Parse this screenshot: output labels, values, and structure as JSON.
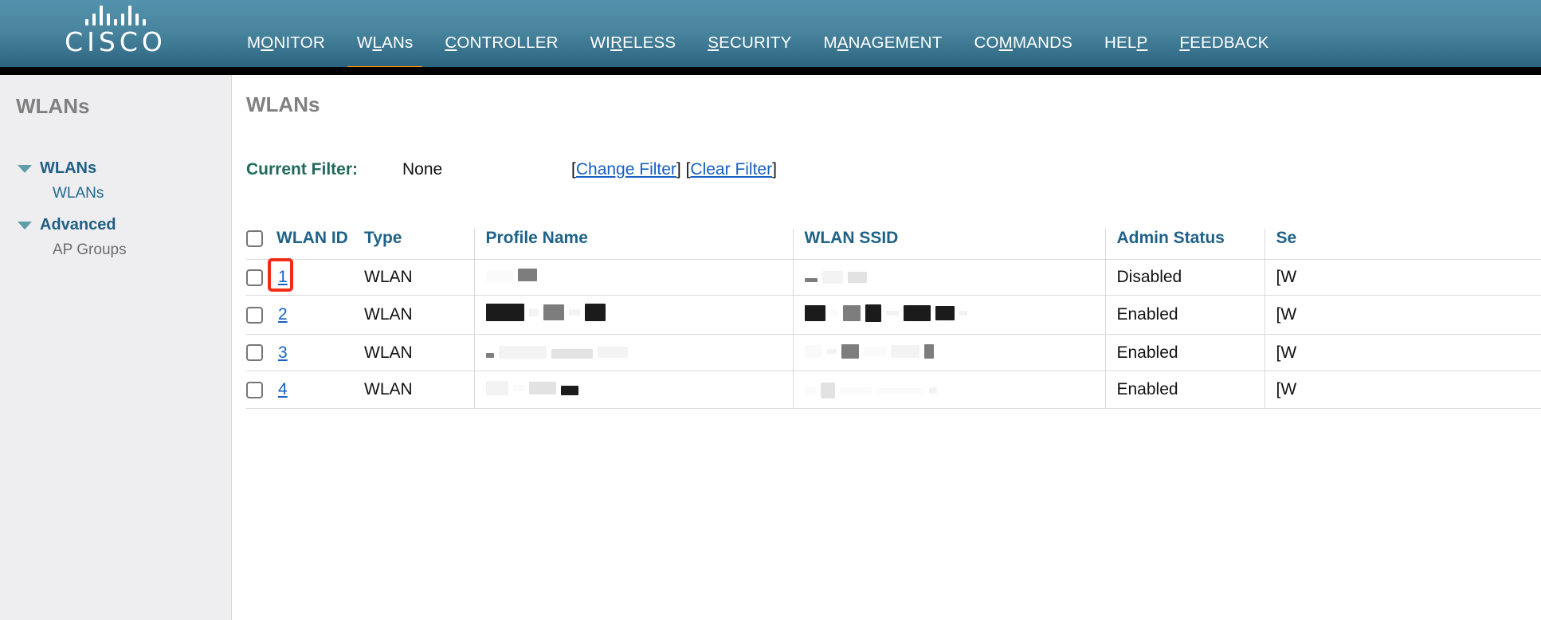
{
  "header": {
    "logo_name": "CISCO",
    "nav": [
      {
        "label": "MONITOR",
        "accesskey_index": 1,
        "active": false
      },
      {
        "label": "WLANs",
        "accesskey_index": 1,
        "active": true
      },
      {
        "label": "CONTROLLER",
        "accesskey_index": 0,
        "active": false
      },
      {
        "label": "WIRELESS",
        "accesskey_index": 2,
        "active": false
      },
      {
        "label": "SECURITY",
        "accesskey_index": 0,
        "active": false
      },
      {
        "label": "MANAGEMENT",
        "accesskey_index": 1,
        "active": false
      },
      {
        "label": "COMMANDS",
        "accesskey_index": 2,
        "active": false
      },
      {
        "label": "HELP",
        "accesskey_index": 3,
        "active": false
      },
      {
        "label": "FEEDBACK",
        "accesskey_index": 0,
        "active": false
      }
    ]
  },
  "sidebar": {
    "title": "WLANs",
    "groups": [
      {
        "label": "WLANs",
        "expanded": true,
        "items": [
          {
            "label": "WLANs",
            "style": "link"
          }
        ]
      },
      {
        "label": "Advanced",
        "expanded": true,
        "items": [
          {
            "label": "AP Groups",
            "style": "muted"
          }
        ]
      }
    ]
  },
  "content": {
    "title": "WLANs",
    "filter": {
      "label": "Current Filter:",
      "value": "None",
      "open_bracket": "[",
      "change_link": "Change Filter",
      "mid_brackets": "] [",
      "clear_link": "Clear Filter",
      "close_bracket": "]"
    },
    "table": {
      "columns": [
        {
          "key": "check",
          "label": ""
        },
        {
          "key": "id",
          "label": "WLAN ID"
        },
        {
          "key": "type",
          "label": "Type"
        },
        {
          "key": "profile",
          "label": "Profile Name"
        },
        {
          "key": "ssid",
          "label": "WLAN SSID"
        },
        {
          "key": "admin",
          "label": "Admin Status"
        },
        {
          "key": "sec",
          "label": "Se"
        }
      ],
      "rows": [
        {
          "id": "1",
          "id_highlighted": true,
          "type": "WLAN",
          "profile_redacted": true,
          "ssid_redacted": true,
          "admin": "Disabled",
          "security": "[W"
        },
        {
          "id": "2",
          "id_highlighted": false,
          "type": "WLAN",
          "profile_redacted": true,
          "ssid_redacted": true,
          "admin": "Enabled",
          "security": "[W"
        },
        {
          "id": "3",
          "id_highlighted": false,
          "type": "WLAN",
          "profile_redacted": true,
          "ssid_redacted": true,
          "admin": "Enabled",
          "security": "[W"
        },
        {
          "id": "4",
          "id_highlighted": false,
          "type": "WLAN",
          "profile_redacted": true,
          "ssid_redacted": true,
          "admin": "Enabled",
          "security": "[W"
        }
      ]
    }
  },
  "colors": {
    "header_top": "#5492ad",
    "header_bottom": "#2d6480",
    "active_tab": "#ff9500",
    "link": "#1660c4",
    "table_header_text": "#1f6288",
    "filter_label": "#1f6a5a",
    "sidebar_bg": "#eeeef0",
    "annotation": "#f22c18"
  }
}
